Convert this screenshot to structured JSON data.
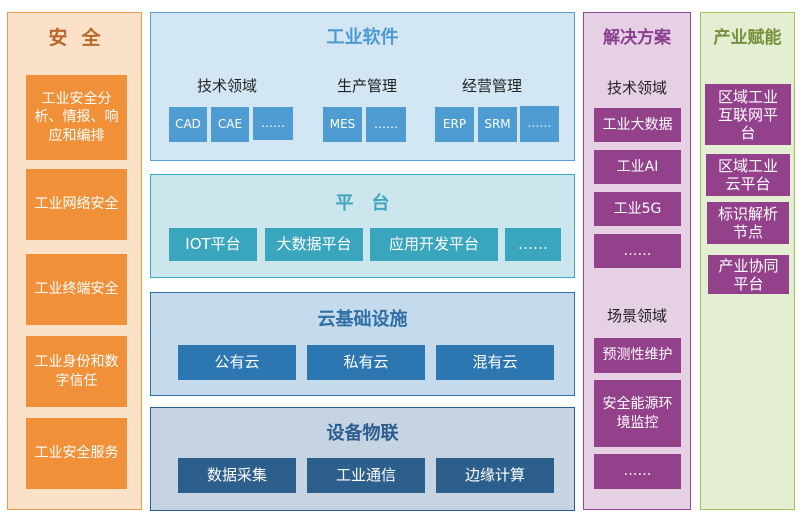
{
  "security": {
    "title": "安全",
    "items": [
      "工业安全分析、情报、响应和编排",
      "工业网络安全",
      "工业终端安全",
      "工业身份和数字信任",
      "工业安全服务"
    ]
  },
  "software": {
    "title": "工业软件",
    "groups": [
      {
        "label": "技术领域",
        "items": [
          "CAD",
          "CAE",
          "……"
        ]
      },
      {
        "label": "生产管理",
        "items": [
          "MES",
          "……"
        ]
      },
      {
        "label": "经营管理",
        "items": [
          "ERP",
          "SRM",
          "……"
        ]
      }
    ]
  },
  "platform": {
    "title": "平台",
    "items": [
      "IOT平台",
      "大数据平台",
      "应用开发平台",
      "……"
    ]
  },
  "cloud": {
    "title": "云基础设施",
    "items": [
      "公有云",
      "私有云",
      "混有云"
    ]
  },
  "iot": {
    "title": "设备物联",
    "items": [
      "数据采集",
      "工业通信",
      "边缘计算"
    ]
  },
  "solutions": {
    "title": "解决方案",
    "tech_label": "技术领域",
    "tech_items": [
      "工业大数据",
      "工业AI",
      "工业5G",
      "……"
    ],
    "scene_label": "场景领域",
    "scene_items": [
      "预测性维护",
      "安全能源环境监控",
      "……"
    ]
  },
  "empowerment": {
    "title": "产业赋能",
    "items": [
      "区域工业互联网平台",
      "区域工业云平台",
      "标识解析节点",
      "产业协同平台"
    ]
  },
  "colors": {
    "security": "#f0913a",
    "software": "#4f9cd3",
    "platform": "#3aa6bd",
    "cloud": "#2c76b1",
    "iot": "#2d5f8c",
    "solutions": "#94418c",
    "empowerment_bg": "#e3eed3"
  }
}
